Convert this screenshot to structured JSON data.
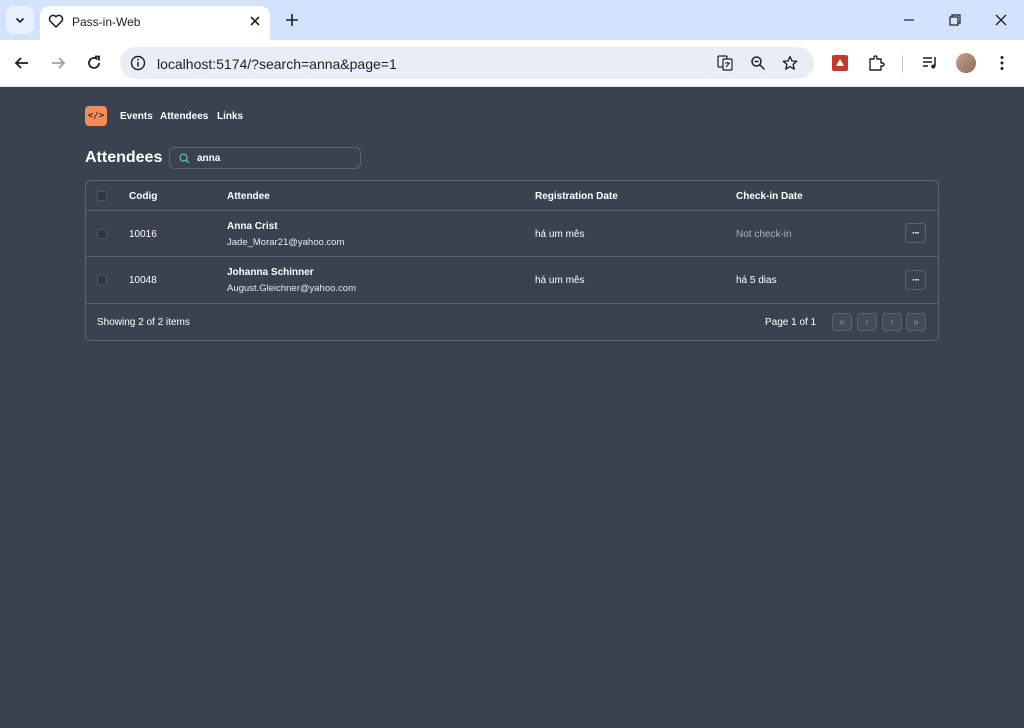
{
  "browser": {
    "tab_title": "Pass-in-Web",
    "url": "localhost:5174/?search=anna&page=1"
  },
  "app": {
    "logo": "</>",
    "nav": [
      "Events",
      "Attendees",
      "Links"
    ],
    "title": "Attendees",
    "search_value": "anna"
  },
  "table": {
    "columns": [
      "Codig",
      "Attendee",
      "Registration Date",
      "Check-in Date"
    ],
    "rows": [
      {
        "code": "10016",
        "name": "Anna Crist",
        "email": "Jade_Morar21@yahoo.com",
        "registered": "há um mês",
        "checkin": "Not check-in"
      },
      {
        "code": "10048",
        "name": "Johanna Schinner",
        "email": "August.Gleichner@yahoo.com",
        "registered": "há um mês",
        "checkin": "há 5 dias"
      }
    ],
    "more_label": "···",
    "footer_count": "Showing 2 of 2 items",
    "footer_page": "Page 1 of 1",
    "pager": [
      "«",
      "‹",
      "›",
      "»"
    ]
  },
  "colors": {
    "accent": "#f48c57",
    "background": "#3a4250",
    "border": "#5b6474"
  }
}
